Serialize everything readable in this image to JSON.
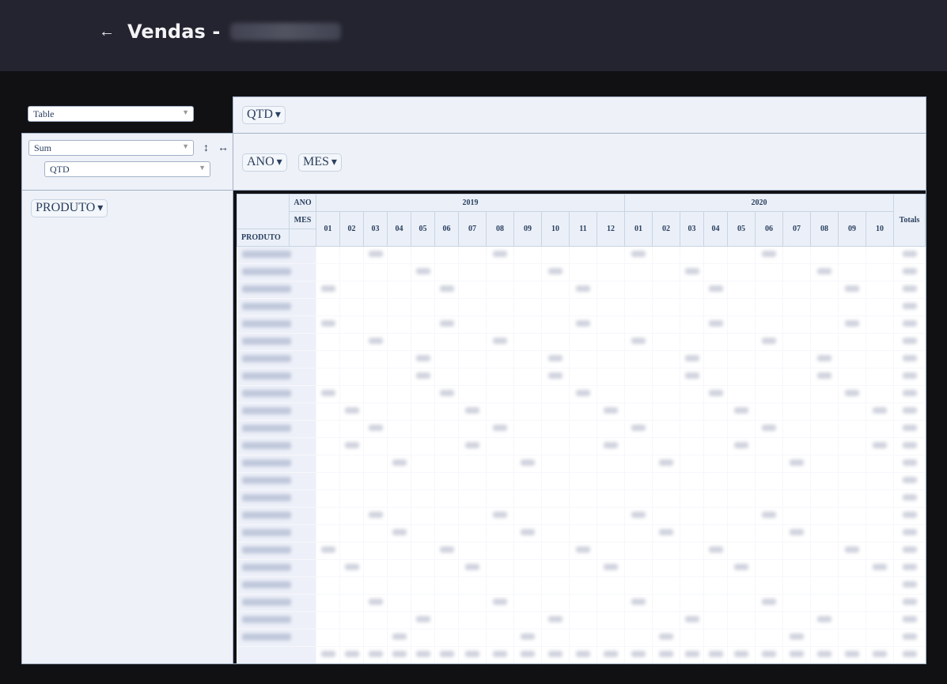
{
  "header": {
    "back_icon": "arrow-left-icon",
    "title": "Vendas - "
  },
  "pivot": {
    "renderer": "Table",
    "aggregator": "Sum",
    "aggregator_value": "QTD",
    "sort_rows_icon": "↕",
    "sort_cols_icon": "↔",
    "unused_attrs": [
      "QTD"
    ],
    "col_attrs": [
      "ANO",
      "MES"
    ],
    "row_attrs": [
      "PRODUTO"
    ],
    "table": {
      "ano_label": "ANO",
      "mes_label": "MES",
      "produto_label": "PRODUTO",
      "totals_label": "Totals",
      "years": [
        {
          "year": "2019",
          "months": [
            "01",
            "02",
            "03",
            "04",
            "05",
            "06",
            "07",
            "08",
            "09",
            "10",
            "11",
            "12"
          ]
        },
        {
          "year": "2020",
          "months": [
            "01",
            "02",
            "03",
            "04",
            "05",
            "06",
            "07",
            "08",
            "09",
            "10"
          ]
        }
      ]
    }
  }
}
